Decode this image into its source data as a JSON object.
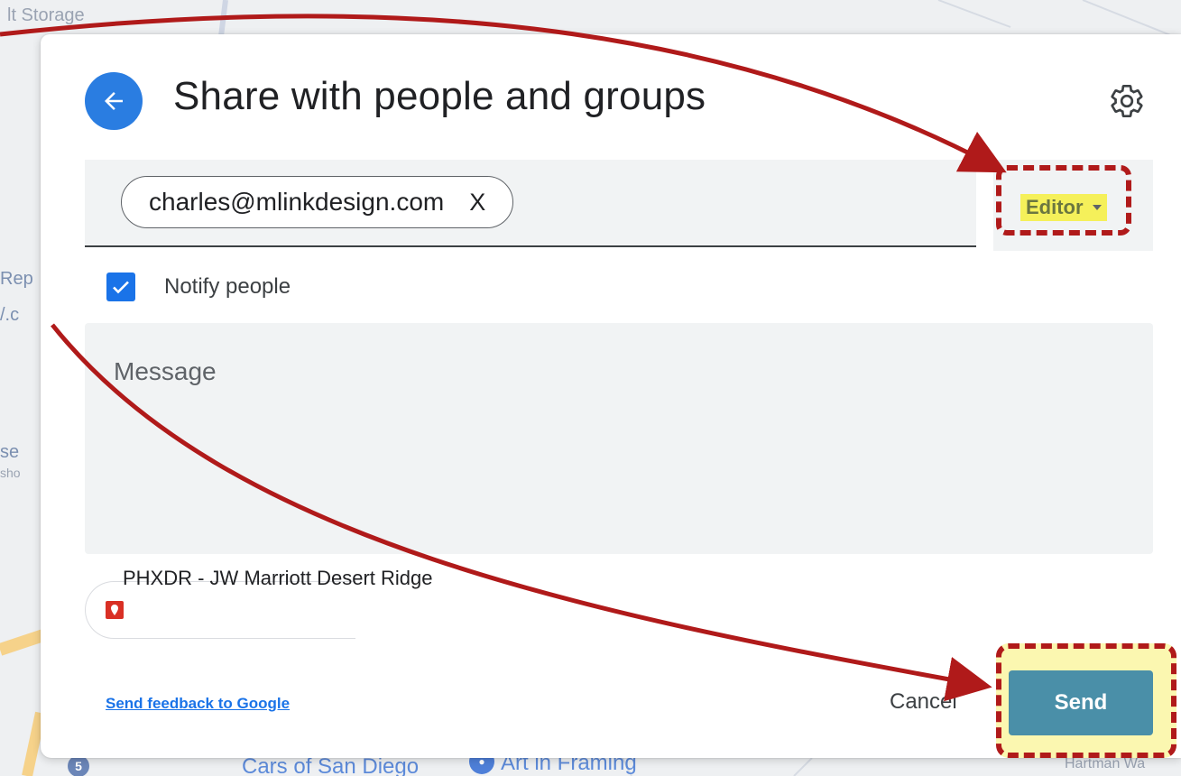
{
  "map": {
    "labels": {
      "top": "lt Storage",
      "rep": "Rep",
      "vc": "/.c",
      "se": "se",
      "sho": "sho",
      "cars": "Cars of San Diego",
      "art": "Art in Framing",
      "hartman": "Hartman Wa"
    },
    "pin_label": "5"
  },
  "dialog": {
    "title": "Share with people and groups",
    "back_icon": "arrow-left-icon",
    "settings_icon": "gear-icon",
    "recipient": {
      "email": "charles@mlinkdesign.com",
      "remove_label": "X"
    },
    "role": {
      "label": "Editor",
      "caret_icon": "chevron-down-icon"
    },
    "notify": {
      "checked": true,
      "label": "Notify people"
    },
    "message": {
      "placeholder": "Message"
    },
    "place_chip": {
      "icon": "map-pin-icon",
      "label": "PHXDR - JW Marriott Desert Ridge"
    },
    "feedback_link": "Send feedback to Google",
    "cancel_label": "Cancel",
    "send_label": "Send"
  },
  "colors": {
    "accent": "#1a73e8",
    "send_button": "#4a8fa8",
    "annotation": "#b01a1a",
    "highlight": "#f5f05a"
  }
}
